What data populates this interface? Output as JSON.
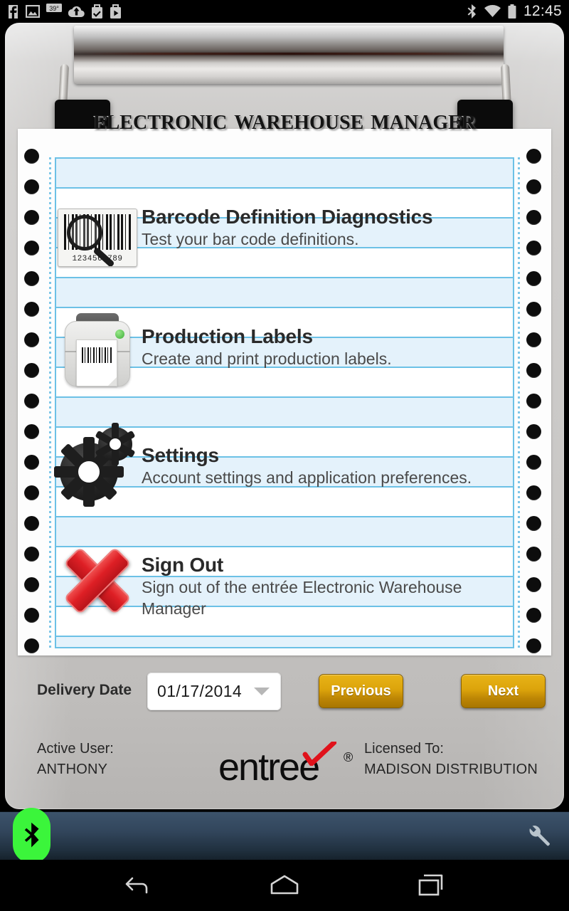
{
  "statusbar": {
    "left_icons": [
      "facebook-icon",
      "photos-icon",
      "weather-icon",
      "cloud-upload-icon",
      "tasks-icon",
      "play-store-icon"
    ],
    "weather_temp": "39°",
    "right_icons": [
      "bluetooth-icon",
      "wifi-icon",
      "battery-icon"
    ],
    "time": "12:45"
  },
  "app": {
    "title": "Electronic Warehouse Manager"
  },
  "menu": {
    "items": [
      {
        "icon": "barcode-scan-icon",
        "title": "Barcode Definition Diagnostics",
        "subtitle": "Test your bar code definitions.",
        "barcode_number": "123456 789"
      },
      {
        "icon": "printer-label-icon",
        "title": "Production Labels",
        "subtitle": "Create and print production labels."
      },
      {
        "icon": "gears-icon",
        "title": "Settings",
        "subtitle": "Account settings and application preferences."
      },
      {
        "icon": "red-x-icon",
        "title": "Sign Out",
        "subtitle": "Sign out of the entrée Electronic Warehouse Manager"
      }
    ]
  },
  "controls": {
    "delivery_date_label": "Delivery Date",
    "delivery_date_value": "01/17/2014",
    "previous_label": "Previous",
    "next_label": "Next"
  },
  "footer": {
    "active_user_label": "Active User:",
    "active_user_value": "ANTHONY",
    "licensed_to_label": "Licensed To:",
    "licensed_to_value": "MADISON DISTRIBUTION",
    "logo_text": "entree",
    "logo_registered": "®"
  },
  "appbar": {
    "bluetooth_icon": "bluetooth-icon",
    "settings_icon": "wrench-icon"
  },
  "navbar": {
    "back_icon": "back-icon",
    "home_icon": "home-icon",
    "recents_icon": "recents-icon"
  },
  "colors": {
    "accent_gold": "#dca40b",
    "rule_blue": "#6cc1e6",
    "band_blue": "#e4f2fb",
    "danger_red": "#de1f25",
    "bluetooth_green": "#3bf53b"
  }
}
